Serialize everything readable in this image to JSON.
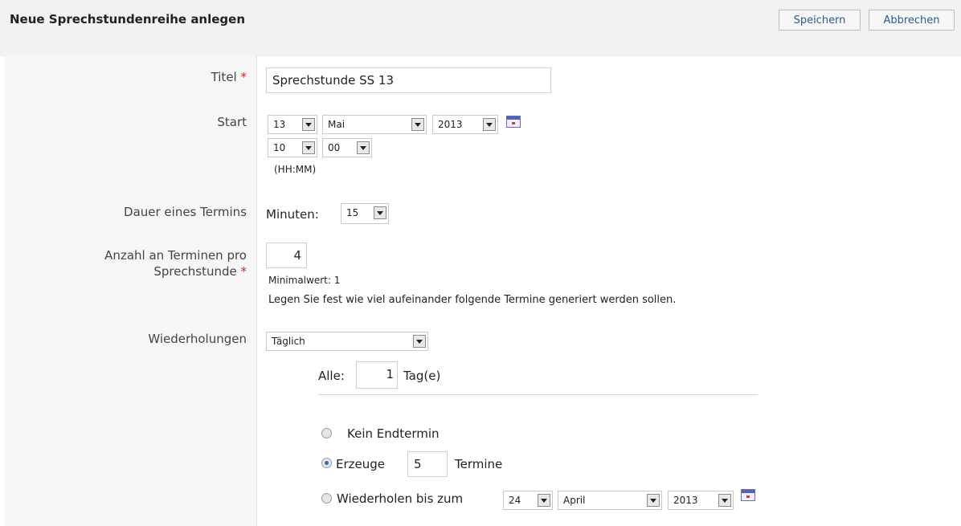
{
  "header": {
    "title": "Neue Sprechstundenreihe anlegen",
    "save_label": "Speichern",
    "cancel_label": "Abbrechen"
  },
  "form": {
    "title": {
      "label": "Titel",
      "required_mark": "*",
      "value": "Sprechstunde SS 13"
    },
    "start": {
      "label": "Start",
      "day": "13",
      "month": "Mai",
      "year": "2013",
      "hour": "10",
      "minute": "00",
      "hint": "(HH:MM)",
      "calendar_icon": "calendar-icon"
    },
    "duration": {
      "label": "Dauer eines Termins",
      "prefix": "Minuten:",
      "value": "15"
    },
    "count": {
      "label_line1": "Anzahl an Terminen pro",
      "label_line2": "Sprechstunde",
      "required_mark": "*",
      "value": "4",
      "min_hint": "Minimalwert: 1",
      "help": "Legen Sie fest wie viel aufeinander folgende Termine generiert werden sollen."
    },
    "repeat": {
      "label": "Wiederholungen",
      "selected": "Täglich",
      "every_label": "Alle:",
      "every_value": "1",
      "every_unit": "Tag(e)",
      "end_options": {
        "none": "Kein Endtermin",
        "create_prefix": "Erzeuge",
        "create_value": "5",
        "create_suffix": "Termine",
        "until_label": "Wiederholen bis zum",
        "until_day": "24",
        "until_month": "April",
        "until_year": "2013",
        "selected": "create"
      }
    }
  }
}
